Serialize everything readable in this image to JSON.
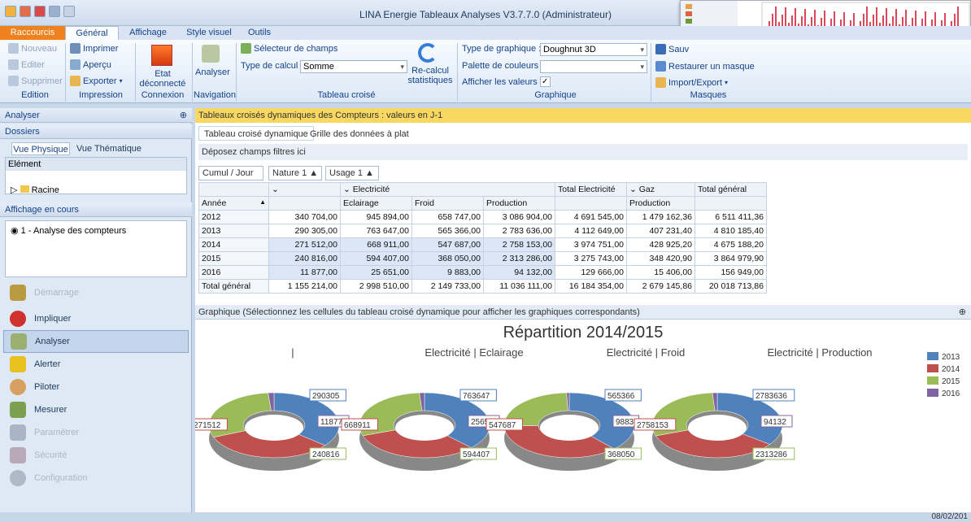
{
  "app": {
    "title": "LINA Energie Tableaux Analyses V3.7.7.0 (Administrateur)"
  },
  "tabs": [
    "Raccourcis",
    "Général",
    "Affichage",
    "Style visuel",
    "Outils"
  ],
  "ribbon": {
    "edition": {
      "new": "Nouveau",
      "edit": "Editer",
      "delete": "Supprimer",
      "group": "Edition"
    },
    "impression": {
      "print": "Imprimer",
      "preview": "Aperçu",
      "export": "Exporter",
      "group": "Impression"
    },
    "connexion": {
      "state": "Etat déconnecté",
      "group": "Connexion"
    },
    "navigation": {
      "analyser": "Analyser",
      "group": "Navigation"
    },
    "tableau": {
      "selector": "Sélecteur de champs",
      "calc_label": "Type de calcul :",
      "calc_value": "Somme",
      "recalc": "Re-calcul statistiques",
      "group": "Tableau croisé"
    },
    "graphique": {
      "type_label": "Type de graphique :",
      "type_value": "Doughnut 3D",
      "palette_label": "Palette de couleurs :",
      "palette_value": "",
      "show_label": "Afficher les valeurs :",
      "show_check": "✓",
      "group": "Graphique"
    },
    "masques": {
      "save": "Sauv",
      "restore": "Restaurer un masque",
      "import": "Import/Export",
      "group": "Masques"
    }
  },
  "left": {
    "analyser": "Analyser",
    "dossiers": "Dossiers",
    "vue_physique": "Vue Physique",
    "vue_thematique": "Vue Thématique",
    "element": "Elément",
    "racine": "Racine",
    "affichage": "Affichage en cours",
    "current": "1 - Analyse des compteurs",
    "nav": [
      "Démarrage",
      "Impliquer",
      "Analyser",
      "Alerter",
      "Piloter",
      "Mesurer",
      "Paramétrer",
      "Sécurité",
      "Configuration"
    ]
  },
  "pivot": {
    "header": "Tableaux croisés dynamiques des Compteurs : valeurs en J-1",
    "tab1": "Tableau croisé dynamique",
    "tab2": "Grille des données à plat",
    "drop": "Déposez champs filtres ici",
    "cumul": "Cumul / Jour",
    "nature": "Nature 1 ▲",
    "usage": "Usage 1 ▲",
    "annee": "Année",
    "cols": {
      "elec": "Electricité",
      "gaz": "Gaz",
      "tot_elec": "Total Electricité",
      "tot_gen": "Total général",
      "eclairage": "Eclairage",
      "froid": "Froid",
      "production": "Production"
    },
    "rows": [
      [
        "2012",
        "340 704,00",
        "945 894,00",
        "658 747,00",
        "3 086 904,00",
        "4 691 545,00",
        "1 479 162,36",
        "6 511 411,36"
      ],
      [
        "2013",
        "290 305,00",
        "763 647,00",
        "565 366,00",
        "2 783 636,00",
        "4 112 649,00",
        "407 231,40",
        "4 810 185,40"
      ],
      [
        "2014",
        "271 512,00",
        "668 911,00",
        "547 687,00",
        "2 758 153,00",
        "3 974 751,00",
        "428 925,20",
        "4 675 188,20"
      ],
      [
        "2015",
        "240 816,00",
        "594 407,00",
        "368 050,00",
        "2 313 286,00",
        "3 275 743,00",
        "348 420,90",
        "3 864 979,90"
      ],
      [
        "2016",
        "11 877,00",
        "25 651,00",
        "9 883,00",
        "94 132,00",
        "129 666,00",
        "15 406,00",
        "156 949,00"
      ],
      [
        "Total général",
        "1 155 214,00",
        "2 998 510,00",
        "2 149 733,00",
        "11 036 111,00",
        "16 184 354,00",
        "2 679 145,86",
        "20 018 713,86"
      ]
    ]
  },
  "chart_header": "Graphique (Sélectionnez les cellules du tableau croisé dynamique pour afficher les graphiques correspondants)",
  "chart_data": {
    "type": "pie",
    "title": "Répartition 2014/2015",
    "legend": [
      "2013",
      "2014",
      "2015",
      "2016"
    ],
    "colors": [
      "#4f81bd",
      "#c0504d",
      "#9bbb59",
      "#8064a2"
    ],
    "charts": [
      {
        "label": "|",
        "values": [
          290305,
          271512,
          240816,
          11877
        ]
      },
      {
        "label": "Electricité | Eclairage",
        "values": [
          763647,
          668911,
          594407,
          25651
        ]
      },
      {
        "label": "Electricité | Froid",
        "values": [
          565366,
          547687,
          368050,
          9883
        ]
      },
      {
        "label": "Electricité | Production",
        "values": [
          2783636,
          2758153,
          2313286,
          94132
        ]
      }
    ]
  },
  "status": "08/02/201"
}
